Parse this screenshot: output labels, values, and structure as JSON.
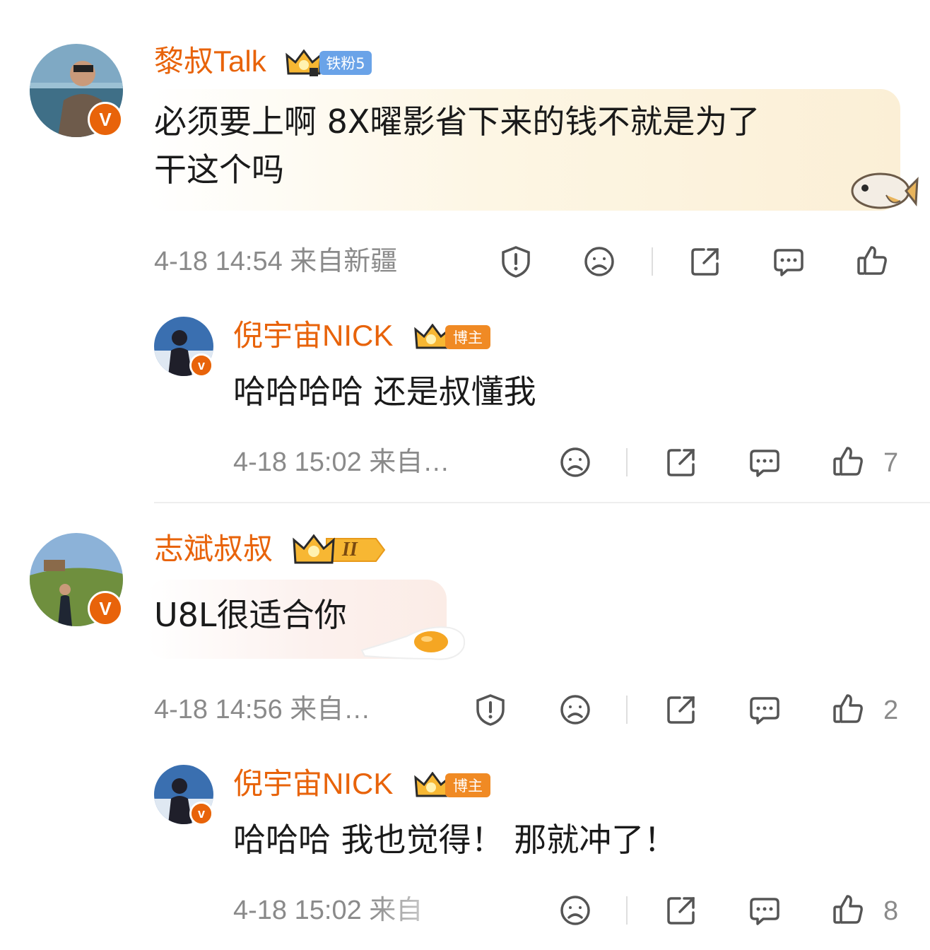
{
  "comments": [
    {
      "username": "黎叔Talk",
      "badge": "铁粉5",
      "text_line1": "必须要上啊 8X曜影省下来的钱不就是为了",
      "text_line2": "干这个吗",
      "meta": "4-18 14:54  来自新疆",
      "colors": {
        "bubble": "#fdf6e4",
        "badge": "#6aa3e8"
      }
    },
    {
      "username": "倪宇宙NICK",
      "badge": "博主",
      "text": "哈哈哈哈 还是叔懂我",
      "meta": "4-18 15:02  来自…",
      "likes": "7",
      "colors": {
        "badge": "#f08a24"
      }
    },
    {
      "username": "志斌叔叔",
      "badge": "II",
      "text": "U8L很适合你",
      "meta": "4-18 14:56  来自…",
      "likes": "2",
      "colors": {
        "bubble": "#fcf1ee",
        "badge": "#f7b733"
      }
    },
    {
      "username": "倪宇宙NICK",
      "badge": "博主",
      "text": "哈哈哈 我也觉得！  那就冲了！",
      "meta": "4-18 15:02  来自",
      "likes": "8",
      "colors": {
        "badge": "#f08a24"
      }
    }
  ],
  "icons": [
    "report-icon",
    "dislike-icon",
    "share-icon",
    "comment-icon",
    "like-icon",
    "verified-v-icon",
    "crown-icon",
    "fish-sticker-icon",
    "egg-sticker-icon"
  ]
}
